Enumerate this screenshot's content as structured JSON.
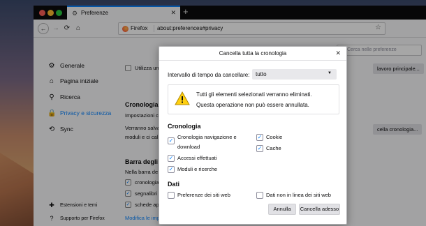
{
  "tab": {
    "title": "Preferenze",
    "close": "✕",
    "new": "+"
  },
  "nav": {
    "back": "←",
    "forward": "→",
    "reload": "⟳",
    "home": "⌂"
  },
  "urlbar": {
    "brand": "Firefox",
    "url": "about:preferences#privacy",
    "star": "☆"
  },
  "sidebar": {
    "items": [
      {
        "label": "Generale",
        "icon": "⚙"
      },
      {
        "label": "Pagina iniziale",
        "icon": "⌂"
      },
      {
        "label": "Ricerca",
        "icon": "⚲"
      },
      {
        "label": "Privacy e sicurezza",
        "icon": "🔒"
      },
      {
        "label": "Sync",
        "icon": "⟲"
      }
    ],
    "footer": [
      {
        "label": "Estensioni e temi",
        "icon": "✚"
      },
      {
        "label": "Supporto per Firefox",
        "icon": "?"
      }
    ]
  },
  "prefs": {
    "search_placeholder": "Cerca nelle preferenze",
    "search_icon": "⚲",
    "utilizza": "Utilizza un",
    "lavoro_btn": "lavoro principale...",
    "cronologia_title": "Cronologia",
    "impostazioni": "Impostazioni c",
    "verranno": "Verranno salva",
    "moduli": "moduli e ci cal",
    "cella_btn": "cella cronologia...",
    "barra_title": "Barra degli i",
    "nella_barra": "Nella barra de",
    "cronologia_item": "cronologia",
    "segnalibri_item": "segnalibri",
    "schede_item": "schede ap",
    "modifica_link": "Modifica le imp"
  },
  "dialog": {
    "title": "Cancella tutta la cronologia",
    "close": "✕",
    "range_label": "Intervallo di tempo da cancellare:",
    "range_value": "tutto",
    "range_arrow": "▼",
    "warning_line1": "Tutti gli elementi selezionati verranno eliminati.",
    "warning_line2": "Questa operazione non può essere annullata.",
    "cronologia_section": "Cronologia",
    "dati_section": "Dati",
    "check_mark": "✓",
    "items": {
      "history_line1": "Cronologia navigazione e",
      "history_line2": "download",
      "logins": "Accessi effettuati",
      "forms": "Moduli e ricerche",
      "cookies": "Cookie",
      "cache": "Cache",
      "site_prefs": "Preferenze dei siti web",
      "offline": "Dati non in linea dei siti web"
    },
    "cancel_button": "Annulla",
    "confirm_button": "Cancella adesso"
  }
}
